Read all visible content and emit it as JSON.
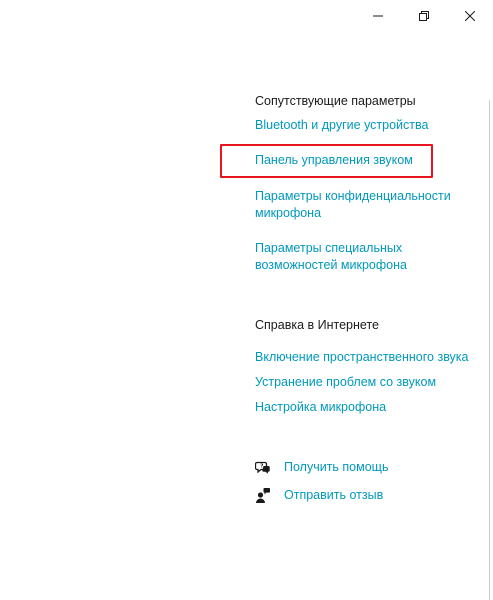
{
  "window_controls": {
    "minimize_icon": "minimize-icon",
    "restore_icon": "restore-icon",
    "close_icon": "close-icon"
  },
  "related_settings": {
    "title": "Сопутствующие параметры",
    "links": [
      "Bluetooth и другие устройства",
      "Панель управления звуком",
      "Параметры конфиденциальности микрофона",
      "Параметры специальных возможностей микрофона"
    ]
  },
  "web_help": {
    "title": "Справка в Интернете",
    "links": [
      "Включение пространственного звука",
      "Устранение проблем со звуком",
      "Настройка микрофона"
    ]
  },
  "support": {
    "get_help": "Получить помощь",
    "send_feedback": "Отправить отзыв"
  },
  "colors": {
    "link": "#0099bc",
    "highlight": "#e8141e",
    "text": "#1a1a1a"
  }
}
